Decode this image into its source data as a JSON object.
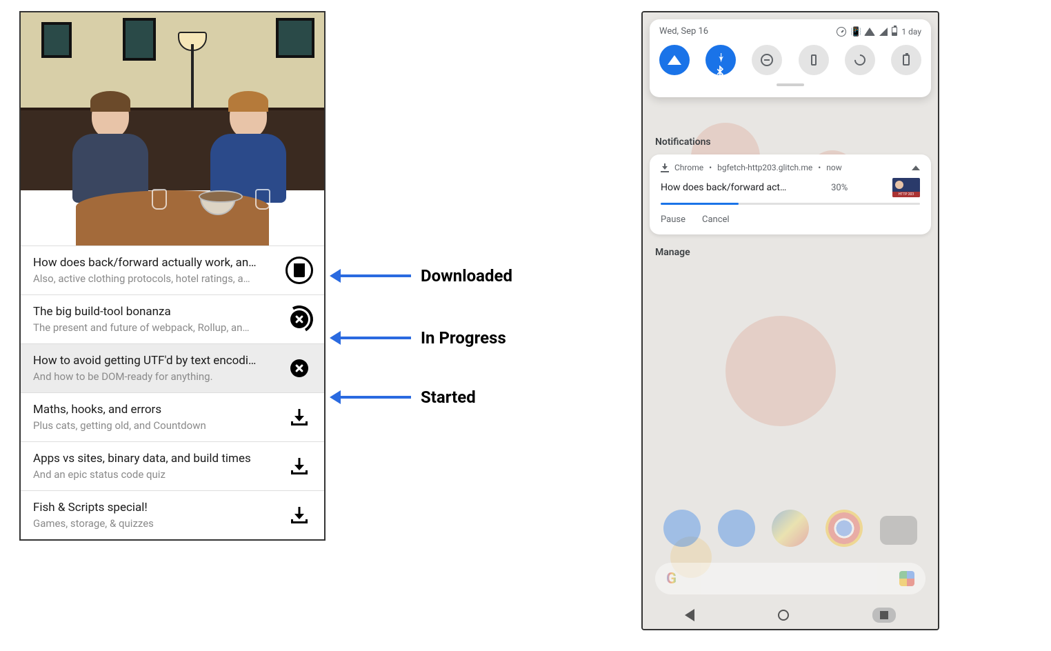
{
  "left_app": {
    "items": [
      {
        "title": "How does back/forward actually work, an…",
        "subtitle": "Also, active clothing protocols, hotel ratings, a…",
        "state": "downloaded"
      },
      {
        "title": "The big build-tool bonanza",
        "subtitle": "The present and future of webpack, Rollup, an…",
        "state": "in_progress"
      },
      {
        "title": "How to avoid getting UTF'd by text encodi…",
        "subtitle": "And how to be DOM-ready for anything.",
        "state": "started",
        "selected": true
      },
      {
        "title": "Maths, hooks, and errors",
        "subtitle": "Plus cats, getting old, and Countdown",
        "state": "idle"
      },
      {
        "title": "Apps vs sites, binary data, and build times",
        "subtitle": "And an epic status code quiz",
        "state": "idle"
      },
      {
        "title": "Fish & Scripts special!",
        "subtitle": "Games, storage, & quizzes",
        "state": "idle"
      }
    ]
  },
  "annotations": {
    "downloaded": "Downloaded",
    "in_progress": "In Progress",
    "started": "Started"
  },
  "right_phone": {
    "status_bar": {
      "date": "Wed, Sep 16",
      "battery_text": "1 day"
    },
    "quick_settings": [
      {
        "name": "wifi",
        "on": true
      },
      {
        "name": "bluetooth",
        "on": true
      },
      {
        "name": "dnd",
        "on": false
      },
      {
        "name": "flashlight",
        "on": false
      },
      {
        "name": "auto_rotate",
        "on": false
      },
      {
        "name": "battery_saver",
        "on": false
      }
    ],
    "notifications_header": "Notifications",
    "notification": {
      "app": "Chrome",
      "source": "bgfetch-http203.glitch.me",
      "time": "now",
      "title": "How does back/forward act…",
      "percent_text": "30%",
      "percent_value": 30,
      "actions": {
        "pause": "Pause",
        "cancel": "Cancel"
      }
    },
    "manage_label": "Manage"
  }
}
